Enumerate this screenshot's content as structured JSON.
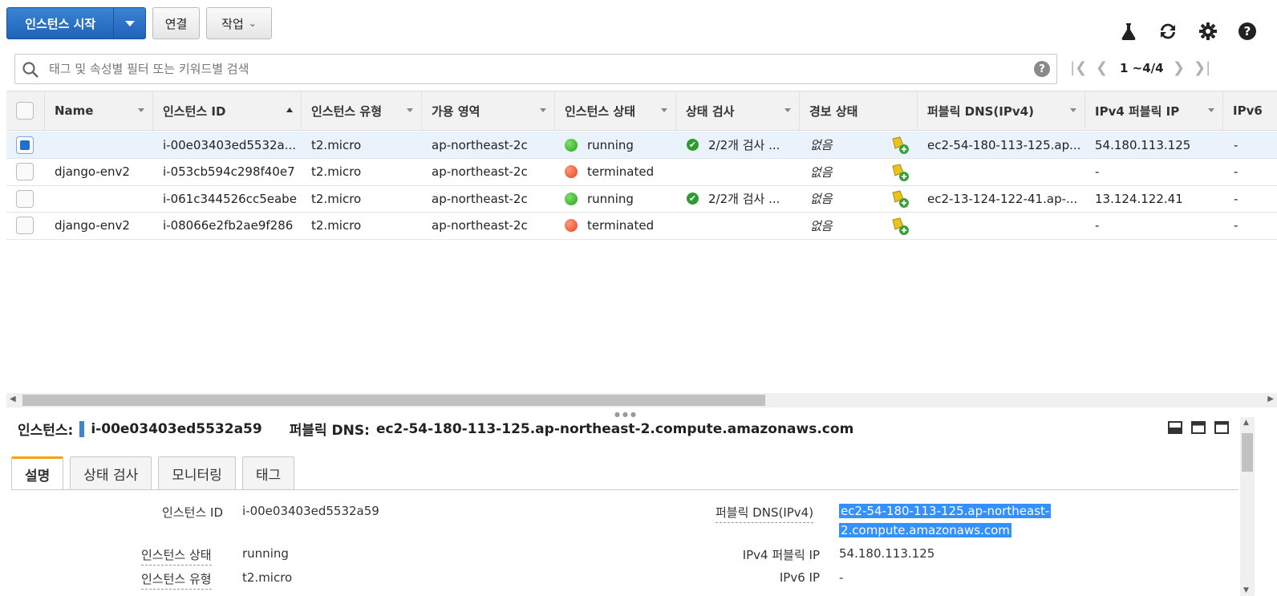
{
  "toolbar": {
    "launch_label": "인스턴스 시작",
    "connect_label": "연결",
    "actions_label": "작업"
  },
  "top_icons": [
    "flask-icon",
    "refresh-icon",
    "gear-icon",
    "help-icon"
  ],
  "search": {
    "placeholder": "태그 및 속성별 필터 또는 키워드별 검색",
    "help": "?"
  },
  "pager": {
    "range": "1 ~4/4"
  },
  "table": {
    "columns": [
      "Name",
      "인스턴스 ID",
      "인스턴스 유형",
      "가용 영역",
      "인스턴스 상태",
      "상태 검사",
      "경보 상태",
      "퍼블릭 DNS(IPv4)",
      "IPv4 퍼블릭 IP",
      "IPv6"
    ],
    "rows": [
      {
        "name": "",
        "id": "i-00e03403ed5532a...",
        "type": "t2.micro",
        "az": "ap-northeast-2c",
        "state": "running",
        "state_color": "#2aa11a",
        "check": "2/2개 검사 ...",
        "alarm": "없음",
        "dns": "ec2-54-180-113-125.ap...",
        "ip": "54.180.113.125",
        "ipv6": "-"
      },
      {
        "name": "django-env2",
        "id": "i-053cb594c298f40e7",
        "type": "t2.micro",
        "az": "ap-northeast-2c",
        "state": "terminated",
        "state_color": "#e8431c",
        "check": "",
        "alarm": "없음",
        "dns": "",
        "ip": "-",
        "ipv6": "-"
      },
      {
        "name": "",
        "id": "i-061c344526cc5eabe",
        "type": "t2.micro",
        "az": "ap-northeast-2c",
        "state": "running",
        "state_color": "#2aa11a",
        "check": "2/2개 검사 ...",
        "alarm": "없음",
        "dns": "ec2-13-124-122-41.ap-...",
        "ip": "13.124.122.41",
        "ipv6": "-"
      },
      {
        "name": "django-env2",
        "id": "i-08066e2fb2ae9f286",
        "type": "t2.micro",
        "az": "ap-northeast-2c",
        "state": "terminated",
        "state_color": "#e8431c",
        "check": "",
        "alarm": "없음",
        "dns": "",
        "ip": "-",
        "ipv6": "-"
      }
    ]
  },
  "detail": {
    "instance_label": "인스턴스:",
    "instance_id": "i-00e03403ed5532a59",
    "dns_label": "퍼블릭 DNS:",
    "dns_value": "ec2-54-180-113-125.ap-northeast-2.compute.amazonaws.com",
    "tabs": [
      "설명",
      "상태 검사",
      "모니터링",
      "태그"
    ],
    "fields_left": [
      {
        "label": "인스턴스 ID",
        "value": "i-00e03403ed5532a59"
      },
      {
        "label": "인스턴스 상태",
        "value": "running"
      },
      {
        "label": "인스턴스 유형",
        "value": "t2.micro"
      }
    ],
    "fields_right": [
      {
        "label": "퍼블릭 DNS(IPv4)",
        "value_line1": "ec2-54-180-113-125.ap-northeast-",
        "value_line2": "2.compute.amazonaws.com"
      },
      {
        "label": "IPv4 퍼블릭 IP",
        "value": "54.180.113.125"
      },
      {
        "label": "IPv6 IP",
        "value": "-"
      }
    ]
  }
}
